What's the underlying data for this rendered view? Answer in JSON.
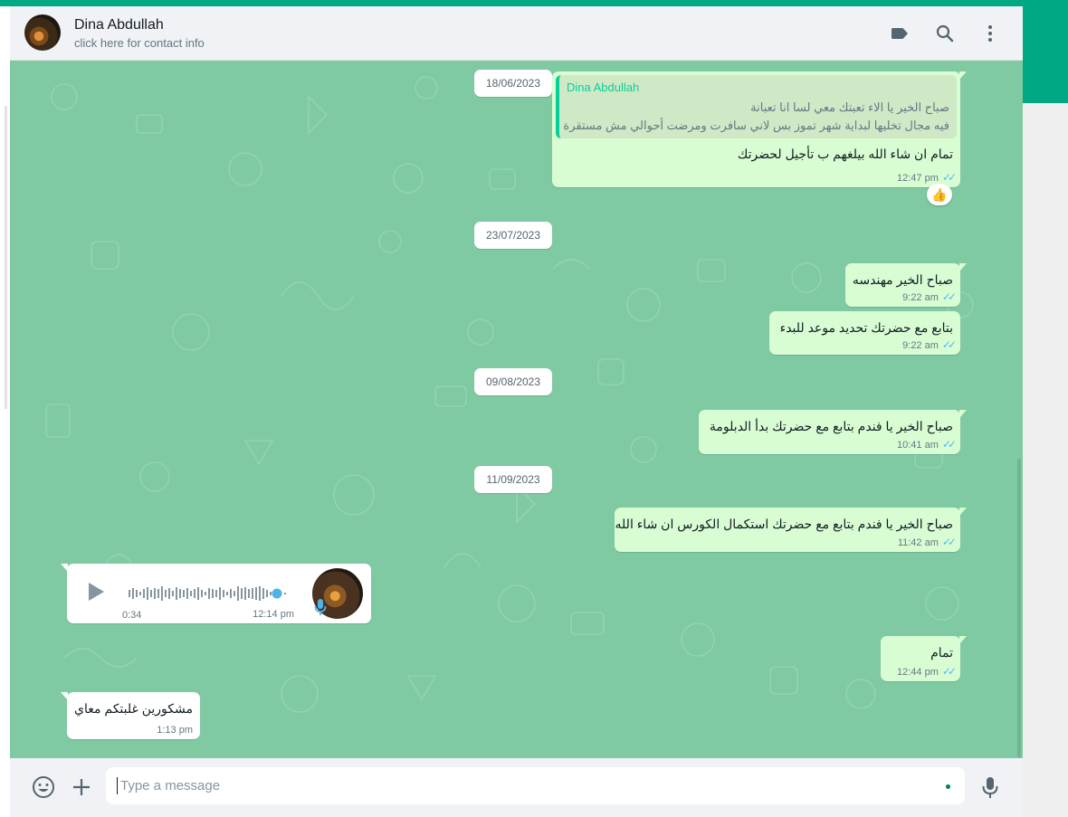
{
  "header": {
    "contact_name": "Dina Abdullah",
    "contact_subtitle": "click here for contact info",
    "icons": [
      "label-icon",
      "search-icon",
      "menu-icon"
    ]
  },
  "chat": {
    "dates": [
      "18/06/2023",
      "23/07/2023",
      "09/08/2023",
      "11/09/2023"
    ],
    "reply_message": {
      "quoted_author": "Dina Abdullah",
      "quoted_line1": "صباح الخير يا الاء تعبتك معي لسا انا تعبانة",
      "quoted_line2": "فيه مجال تخليها لبداية شهر تموز بس لاني سافرت ومرضت أحوالي مش مستقرة",
      "text": "تمام ان شاء الله بيلغهم ب تأجيل لحضرتك",
      "time": "12:47 pm",
      "reaction": "👍"
    },
    "messages": [
      {
        "text": "صباح الخير مهندسه",
        "time": "9:22 am"
      },
      {
        "text": "بتابع مع حضرتك تحديد موعد للبدء",
        "time": "9:22 am"
      },
      {
        "text": "صباح الخير يا فندم بتابع مع حضرتك بدأ الدبلومة",
        "time": "10:41 am"
      },
      {
        "text": "صباح الخير يا فندم بتابع مع حضرتك استكمال الكورس ان شاء الله",
        "time": "11:42 am"
      },
      {
        "text": "تمام",
        "time": "12:44 pm"
      }
    ],
    "voice_message": {
      "duration": "0:34",
      "time": "12:14 pm"
    },
    "incoming_message": {
      "text": "مشكورين غلبتكم معاي",
      "time": "1:13 pm"
    },
    "ticks": "✓✓"
  },
  "composer": {
    "placeholder": "Type a message"
  },
  "colors": {
    "accent": "#00a884",
    "chat_bg": "#7fcaa2",
    "outgoing_bubble": "#d9fdd3",
    "read_ticks": "#53bdeb"
  }
}
